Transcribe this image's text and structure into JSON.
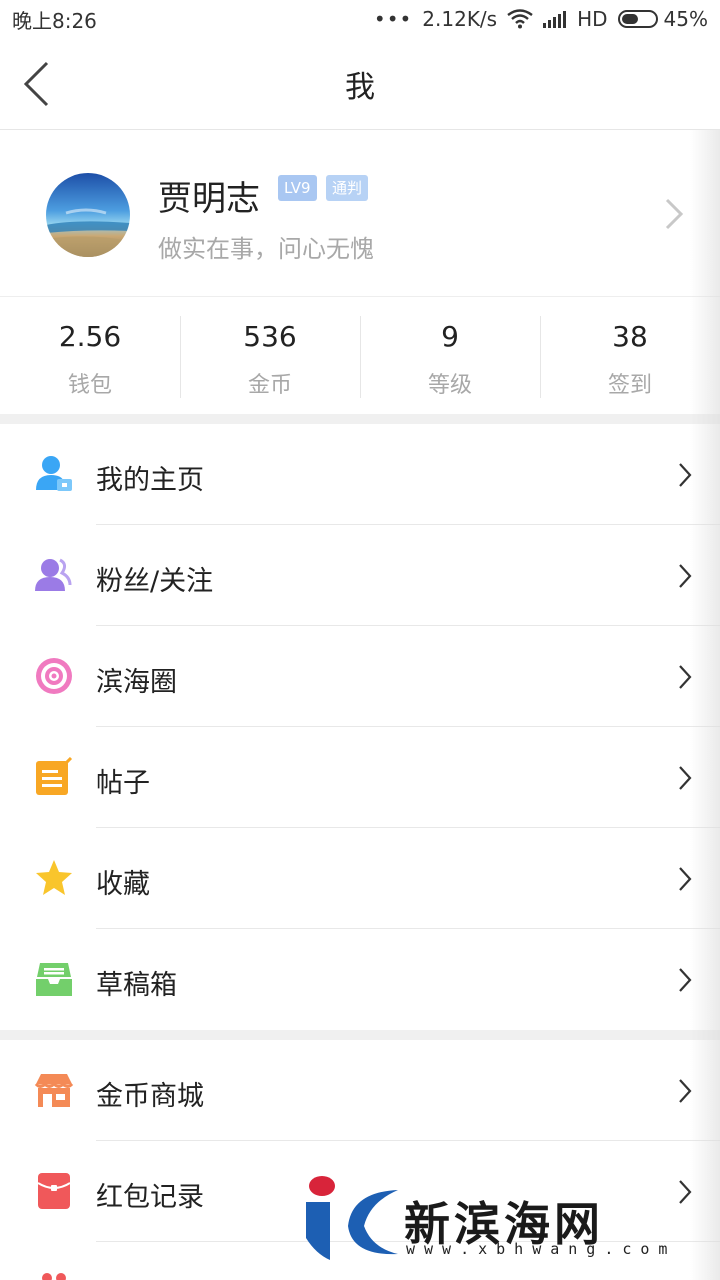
{
  "status_bar": {
    "time": "晚上8:26",
    "dots": "•••",
    "net_speed": "2.12K/s",
    "network_type": "HD",
    "battery_percent": "45%",
    "battery_level": 0.45
  },
  "navbar": {
    "title": "我",
    "back_icon": "chevron-left-icon"
  },
  "profile": {
    "name": "贾明志",
    "level_badge": "LV9",
    "rank_badge": "通判",
    "motto": "做实在事，问心无愧"
  },
  "stats": [
    {
      "value": "2.56",
      "label": "钱包"
    },
    {
      "value": "536",
      "label": "金币"
    },
    {
      "value": "9",
      "label": "等级"
    },
    {
      "value": "38",
      "label": "签到"
    }
  ],
  "menu_group_1": [
    {
      "label": "我的主页",
      "icon": "user-home-icon",
      "color": "#3aa6f5"
    },
    {
      "label": "粉丝/关注",
      "icon": "fans-icon",
      "color": "#9b7be6"
    },
    {
      "label": "滨海圈",
      "icon": "circle-icon",
      "color": "#f07ac0"
    },
    {
      "label": "帖子",
      "icon": "post-icon",
      "color": "#f8a724"
    },
    {
      "label": "收藏",
      "icon": "star-icon",
      "color": "#f9c52c"
    },
    {
      "label": "草稿箱",
      "icon": "draft-box-icon",
      "color": "#73cf6b"
    }
  ],
  "menu_group_2": [
    {
      "label": "金币商城",
      "icon": "shop-icon",
      "color": "#f48a56"
    },
    {
      "label": "红包记录",
      "icon": "red-packet-icon",
      "color": "#f0585a"
    }
  ],
  "watermark": {
    "title": "新滨海网",
    "url": "www.xbhwang.com"
  }
}
